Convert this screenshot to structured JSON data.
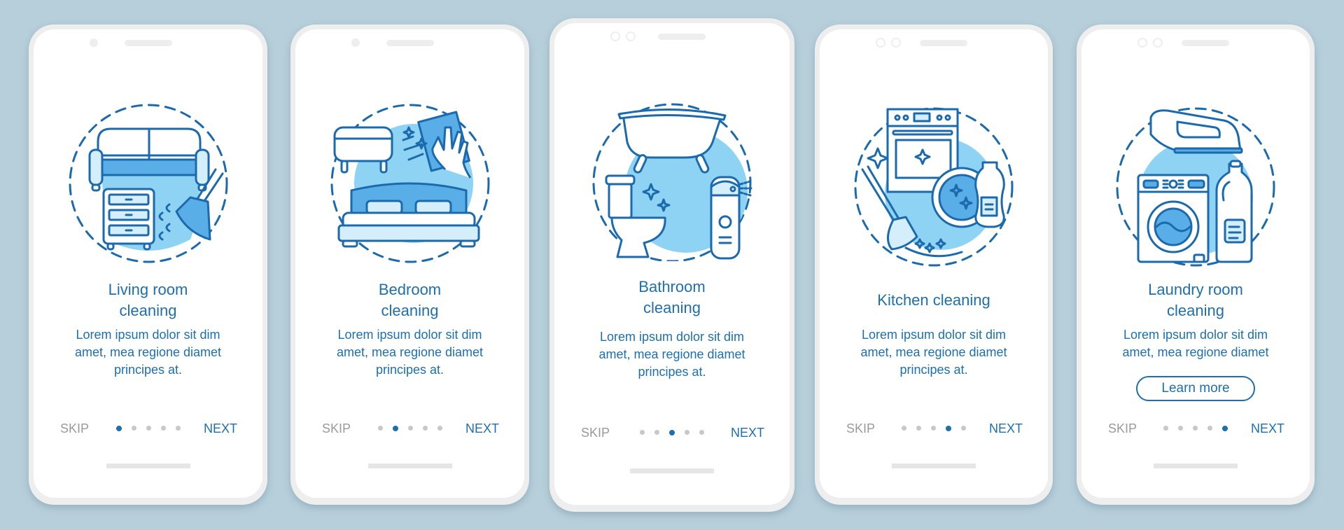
{
  "colors": {
    "background": "#b7cfdb",
    "accent": "#1e6fae",
    "illustration_fill": "#8fd3f4",
    "inactive_dot": "#c8c8c8",
    "skip_text": "#9a9a9a"
  },
  "screens": [
    {
      "title_lines": [
        "Living room",
        "cleaning"
      ],
      "body_lines": [
        "Lorem ipsum dolor sit dim",
        "amet, mea regione diamet",
        "principes at."
      ],
      "skip_label": "SKIP",
      "next_label": "NEXT",
      "active_page": 1,
      "total_pages": 5,
      "illustration": "living-room-icon"
    },
    {
      "title_lines": [
        "Bedroom",
        "cleaning"
      ],
      "body_lines": [
        "Lorem ipsum dolor sit dim",
        "amet, mea regione diamet",
        "principes at."
      ],
      "skip_label": "SKIP",
      "next_label": "NEXT",
      "active_page": 2,
      "total_pages": 5,
      "illustration": "bedroom-icon"
    },
    {
      "title_lines": [
        "Bathroom",
        "cleaning"
      ],
      "body_lines": [
        "Lorem ipsum dolor sit dim",
        "amet, mea regione diamet",
        "principes at."
      ],
      "skip_label": "SKIP",
      "next_label": "NEXT",
      "active_page": 3,
      "total_pages": 5,
      "illustration": "bathroom-icon"
    },
    {
      "title_lines": [
        "Kitchen cleaning"
      ],
      "body_lines": [
        "Lorem ipsum dolor sit dim",
        "amet, mea regione diamet",
        "principes at."
      ],
      "skip_label": "SKIP",
      "next_label": "NEXT",
      "active_page": 4,
      "total_pages": 5,
      "illustration": "kitchen-icon"
    },
    {
      "title_lines": [
        "Laundry room",
        "cleaning"
      ],
      "body_lines": [
        "Lorem ipsum dolor sit dim",
        "amet, mea regione diamet"
      ],
      "button_label": "Learn more",
      "skip_label": "SKIP",
      "next_label": "NEXT",
      "active_page": 5,
      "total_pages": 5,
      "illustration": "laundry-icon"
    }
  ]
}
